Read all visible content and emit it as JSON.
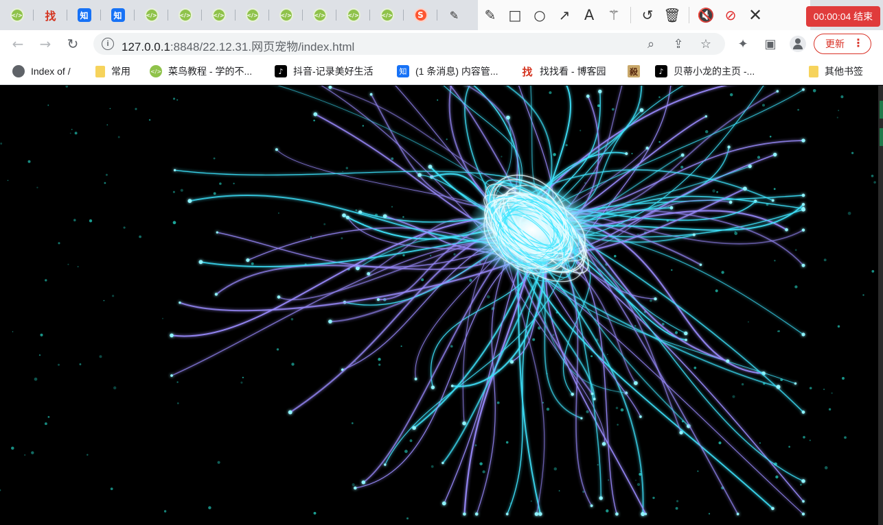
{
  "tabs": [
    {
      "icon": "runoob-icon",
      "glyph": "</>",
      "kind": "runoob"
    },
    {
      "icon": "zhao-icon",
      "glyph": "找",
      "kind": "zhao"
    },
    {
      "icon": "zhihu-icon",
      "glyph": "知",
      "kind": "zhi"
    },
    {
      "icon": "zhihu-icon",
      "glyph": "知",
      "kind": "zhi"
    },
    {
      "icon": "runoob-icon",
      "glyph": "</>",
      "kind": "runoob"
    },
    {
      "icon": "runoob-icon",
      "glyph": "</>",
      "kind": "runoob"
    },
    {
      "icon": "runoob-icon",
      "glyph": "</>",
      "kind": "runoob"
    },
    {
      "icon": "runoob-icon",
      "glyph": "</>",
      "kind": "runoob"
    },
    {
      "icon": "runoob-icon",
      "glyph": "</>",
      "kind": "runoob"
    },
    {
      "icon": "runoob-icon",
      "glyph": "</>",
      "kind": "runoob"
    },
    {
      "icon": "runoob-icon",
      "glyph": "</>",
      "kind": "runoob"
    },
    {
      "icon": "runoob-icon",
      "glyph": "</>",
      "kind": "runoob"
    },
    {
      "icon": "csdn-icon",
      "glyph": "S",
      "kind": "csdn"
    },
    {
      "icon": "draw-icon",
      "glyph": "✎",
      "kind": "draw"
    }
  ],
  "annotation_toolbar": {
    "tools": [
      "pencil-icon",
      "rectangle-icon",
      "circle-icon",
      "arrow-icon",
      "text-icon",
      "magic-wand-icon",
      "undo-icon",
      "trash-icon",
      "speaker-muted-icon",
      "mic-muted-icon",
      "close-icon"
    ],
    "recording_label": "00:00:04 结束"
  },
  "toolbar": {
    "url_host": "127.0.0.1",
    "url_path": ":8848/22.12.31.网页宠物/index.html",
    "update_label": "更新"
  },
  "bookmarks": [
    {
      "label": "Index of /",
      "icon": "globe-icon",
      "kind": "globe",
      "glyph": ""
    },
    {
      "label": "常用",
      "icon": "folder-icon",
      "kind": "folder",
      "glyph": ""
    },
    {
      "label": "菜鸟教程 - 学的不...",
      "icon": "runoob-icon",
      "kind": "runoob",
      "glyph": "</>"
    },
    {
      "label": "抖音-记录美好生活",
      "icon": "tiktok-icon",
      "kind": "tiktok",
      "glyph": "♪"
    },
    {
      "label": "(1 条消息) 内容管...",
      "icon": "zhihu-icon",
      "kind": "zhi",
      "glyph": "知"
    },
    {
      "label": "找找看 - 博客园",
      "icon": "zhao-icon",
      "kind": "zhao",
      "glyph": "找"
    },
    {
      "label": "",
      "icon": "sha-icon",
      "kind": "sha",
      "glyph": "殺"
    },
    {
      "label": "贝蒂小龙的主页 -...",
      "icon": "tiktok-icon",
      "kind": "tiktok",
      "glyph": "♪"
    },
    {
      "label": "其他书签",
      "icon": "folder-icon",
      "kind": "folder",
      "glyph": ""
    }
  ],
  "colors": {
    "accent_red": "#e03b3b",
    "tendril_cyan": "#3fe6ff",
    "tendril_violet": "#9b8cff",
    "particle_teal": "#1fb6a8"
  }
}
